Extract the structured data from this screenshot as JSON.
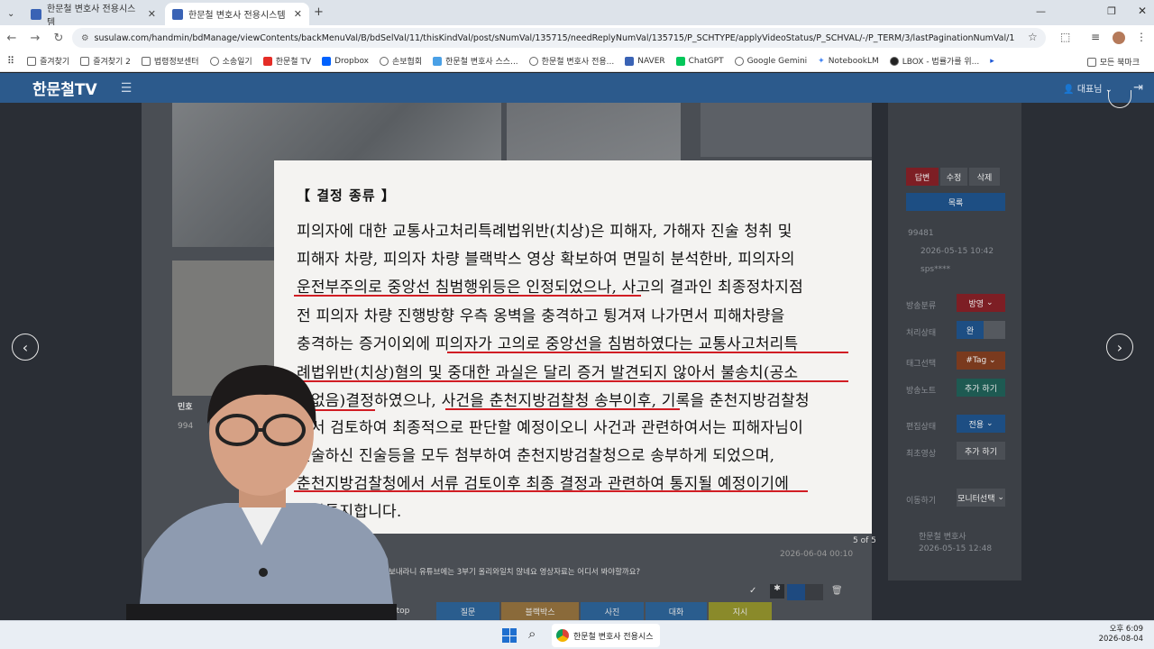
{
  "browser": {
    "tabs": [
      {
        "title": "한문철 변호사 전용시스템"
      },
      {
        "title": "한문철 변호사 전용시스템"
      }
    ],
    "url": "susulaw.com/handmin/bdManage/viewContents/backMenuVal/B/bdSelVal/11/thisKindVal/post/sNumVal/135715/needReplyNumVal/135715/P_SCHTYPE/applyVideoStatus/P_SCHVAL/-/P_TERM/3/lastPaginationNumVal/1",
    "bookmarks": [
      "즐겨찾기",
      "즐겨찾기 2",
      "법령정보센터",
      "소송일기",
      "한문철 TV",
      "Dropbox",
      "손보협회",
      "한문철 변호사 스스...",
      "한문철 변호사 전용...",
      "NAVER",
      "ChatGPT",
      "Google Gemini",
      "NotebookLM",
      "LBOX - 법률가를 위..."
    ],
    "all_bookmarks": "모든 북마크"
  },
  "app": {
    "logo": "한문철TV",
    "user": "대표님"
  },
  "right_panel": {
    "buttons": [
      "답변",
      "수정",
      "삭제"
    ],
    "list_button": "목록",
    "post_number": "99481",
    "post_date": "2026-05-15 10:42",
    "author": "sps****",
    "labels": [
      "방송분류",
      "처리상태",
      "태그선택",
      "방송노트",
      "편집상태",
      "최초영상",
      "이동하기"
    ],
    "values": [
      "방영",
      "완",
      "#Tag",
      "추가 하기",
      "전용",
      "추가 하기",
      "모니터선택"
    ],
    "footer_author": "한문철 변호사",
    "footer_date": "2026-05-15 12:48"
  },
  "document": {
    "title": "【 결정 종류 】",
    "lines": [
      "피의자에 대한 교통사고처리특례법위반(치상)은 피해자, 가해자 진술 청취 및",
      "피해자 차량, 피의자 차량 블랙박스 영상 확보하여 면밀히 분석한바, 피의자의",
      "운전부주의로 중앙선 침범행위등은 인정되었으나, 사고의 결과인 최종정차지점",
      "전 피의자 차량 진행방향 우측 옹벽을 충격하고 튕겨져 나가면서 피해차량을",
      "충격하는 증거이외에 피의자가 고의로 중앙선을 침범하였다는 교통사고처리특",
      "례법위반(치상)혐의 및 중대한 과실은 달리 증거 발견되지 않아서 불송치(공소",
      "권없음)결정하였으나, 사건을 춘천지방검찰청 송부이후, 기록을 춘천지방검찰청",
      "에서 검토하여 최종적으로 판단할 예정이오니 사건과 관련하여서는 피해자님이",
      "진술하신 진술등을 모두 첨부하여 춘천지방검찰청으로 송부하게 되었으며,",
      "춘천지방검찰청에서 서류 검토이후 최종 결정과 관련하여 통지될 예정이기에",
      "결과통지합니다."
    ],
    "page_indicator": "5 of 5"
  },
  "comment": {
    "text": "경찰서에 보내라니 유튜브에는 3부기 올리와일치 않네요 영상자료는 어디서 봐야할까요?",
    "date": "2026-06-04 00:10",
    "side_label": "민호",
    "side_number": "994"
  },
  "bottom_tabs": [
    "top",
    "질문",
    "블랙박스",
    "사진",
    "대화",
    "지시"
  ],
  "taskbar": {
    "app_label": "한문철 변호사 전용시스",
    "time": "오후 6:09",
    "date": "2026-08-04"
  },
  "colors": {
    "header": "#2c5a8c",
    "underline": "#d11d24"
  }
}
